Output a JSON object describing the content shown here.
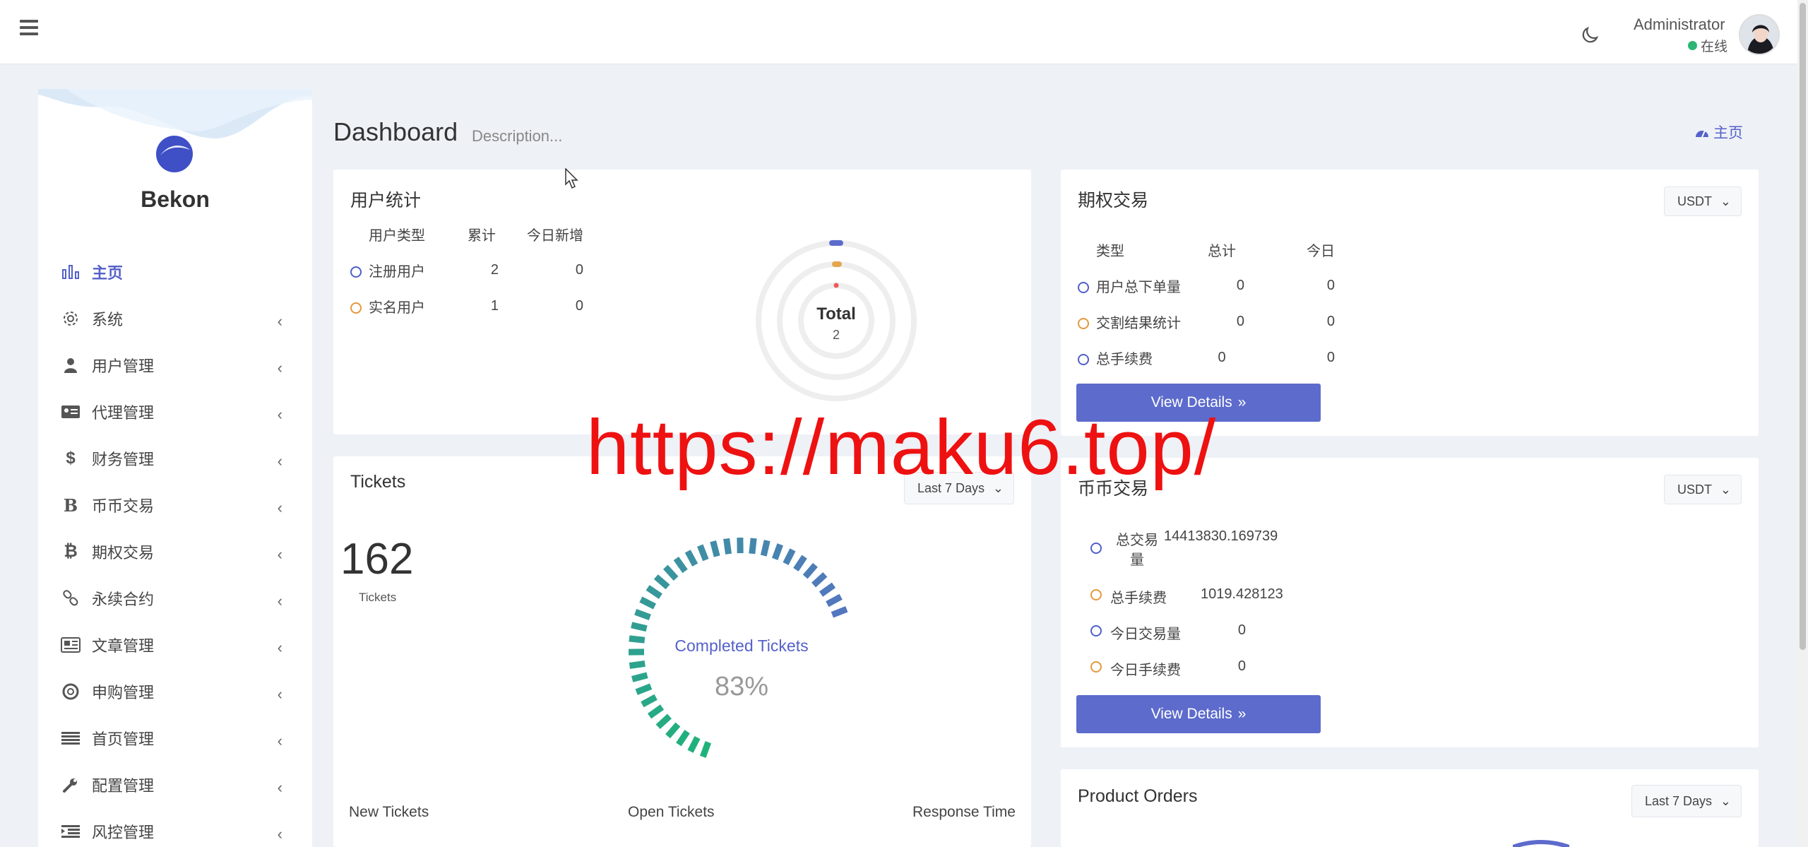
{
  "header": {
    "user_name": "Administrator",
    "user_status": "在线"
  },
  "sidebar": {
    "brand": "Bekon",
    "items": [
      {
        "label": "主页",
        "icon": "bar-chart-icon"
      },
      {
        "label": "系统",
        "icon": "gear-icon"
      },
      {
        "label": "用户管理",
        "icon": "user-icon"
      },
      {
        "label": "代理管理",
        "icon": "id-card-icon"
      },
      {
        "label": "财务管理",
        "icon": "dollar-icon"
      },
      {
        "label": "币币交易",
        "icon": "bold-b-icon"
      },
      {
        "label": "期权交易",
        "icon": "bitcoin-icon"
      },
      {
        "label": "永续合约",
        "icon": "link-icon"
      },
      {
        "label": "文章管理",
        "icon": "newspaper-icon"
      },
      {
        "label": "申购管理",
        "icon": "lifebuoy-icon"
      },
      {
        "label": "首页管理",
        "icon": "list-icon"
      },
      {
        "label": "配置管理",
        "icon": "wrench-icon"
      },
      {
        "label": "风控管理",
        "icon": "indent-icon"
      }
    ]
  },
  "page": {
    "title": "Dashboard",
    "description": "Description...",
    "breadcrumb": "主页"
  },
  "user_stats": {
    "title": "用户统计",
    "headers": [
      "用户类型",
      "累计",
      "今日新增"
    ],
    "rows": [
      {
        "type": "注册用户",
        "total": "2",
        "today": "0"
      },
      {
        "type": "实名用户",
        "total": "1",
        "today": "0"
      }
    ],
    "donut_label": "Total",
    "donut_value": "2"
  },
  "options_trade": {
    "title": "期权交易",
    "currency": "USDT",
    "headers": [
      "类型",
      "总计",
      "今日"
    ],
    "rows": [
      {
        "type": "用户总下单量",
        "total": "0",
        "today": "0"
      },
      {
        "type": "交割结果统计",
        "total": "0",
        "today": "0"
      },
      {
        "type": "总手续费",
        "total": "0",
        "today": "0"
      }
    ],
    "button": "View Details"
  },
  "tickets": {
    "title": "Tickets",
    "range": "Last 7 Days",
    "count": "162",
    "count_label": "Tickets",
    "gauge_label": "Completed Tickets",
    "gauge_value": "83%",
    "gauge_fraction": 0.83,
    "footer": [
      "New Tickets",
      "Open Tickets",
      "Response Time"
    ]
  },
  "spot_trade": {
    "title": "币币交易",
    "currency": "USDT",
    "rows": [
      {
        "label_line1": "总交易",
        "label_line2": "量",
        "value": "14413830.169739"
      },
      {
        "label": "总手续费",
        "value": "1019.428123"
      },
      {
        "label": "今日交易量",
        "value": "0"
      },
      {
        "label": "今日手续费",
        "value": "0"
      }
    ],
    "button": "View Details"
  },
  "product_orders": {
    "title": "Product Orders",
    "range": "Last 7 Days"
  },
  "watermark": "https://maku6.top/"
}
